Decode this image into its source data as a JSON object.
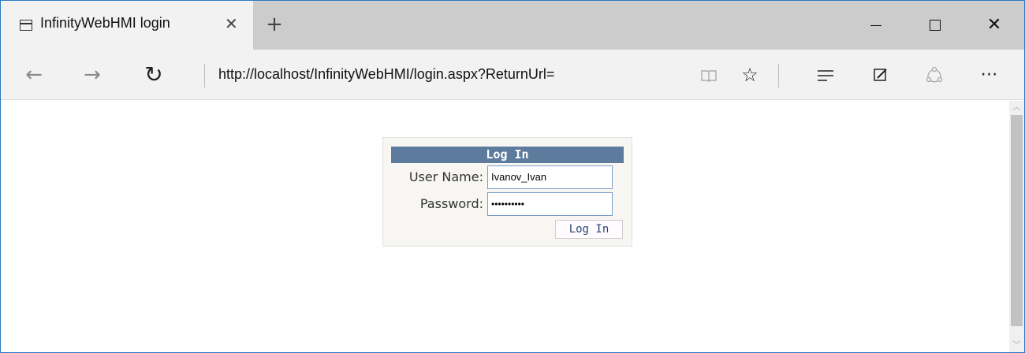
{
  "browser": {
    "tab_title": "InfinityWebHMI login",
    "tab_close_glyph": "✕",
    "new_tab_glyph": "+",
    "url": "http://localhost/InfinityWebHMI/login.aspx?ReturnUrl=",
    "icons": {
      "back": "←",
      "forward": "→",
      "refresh": "↻",
      "reading_view": "📖",
      "favorite": "☆",
      "hub": "☰",
      "web_note": "✎",
      "share": "⚇",
      "more": "⋯",
      "close": "✕"
    }
  },
  "login": {
    "header": "Log In",
    "username_label": "User Name:",
    "username_value": "Ivanov_Ivan",
    "password_label": "Password:",
    "password_value": "••••••••••",
    "submit_label": "Log In"
  },
  "colors": {
    "header_bg": "#5d7b9d",
    "panel_bg": "#f7f6f3",
    "button_text": "#284775",
    "window_border": "#2b79c2"
  }
}
